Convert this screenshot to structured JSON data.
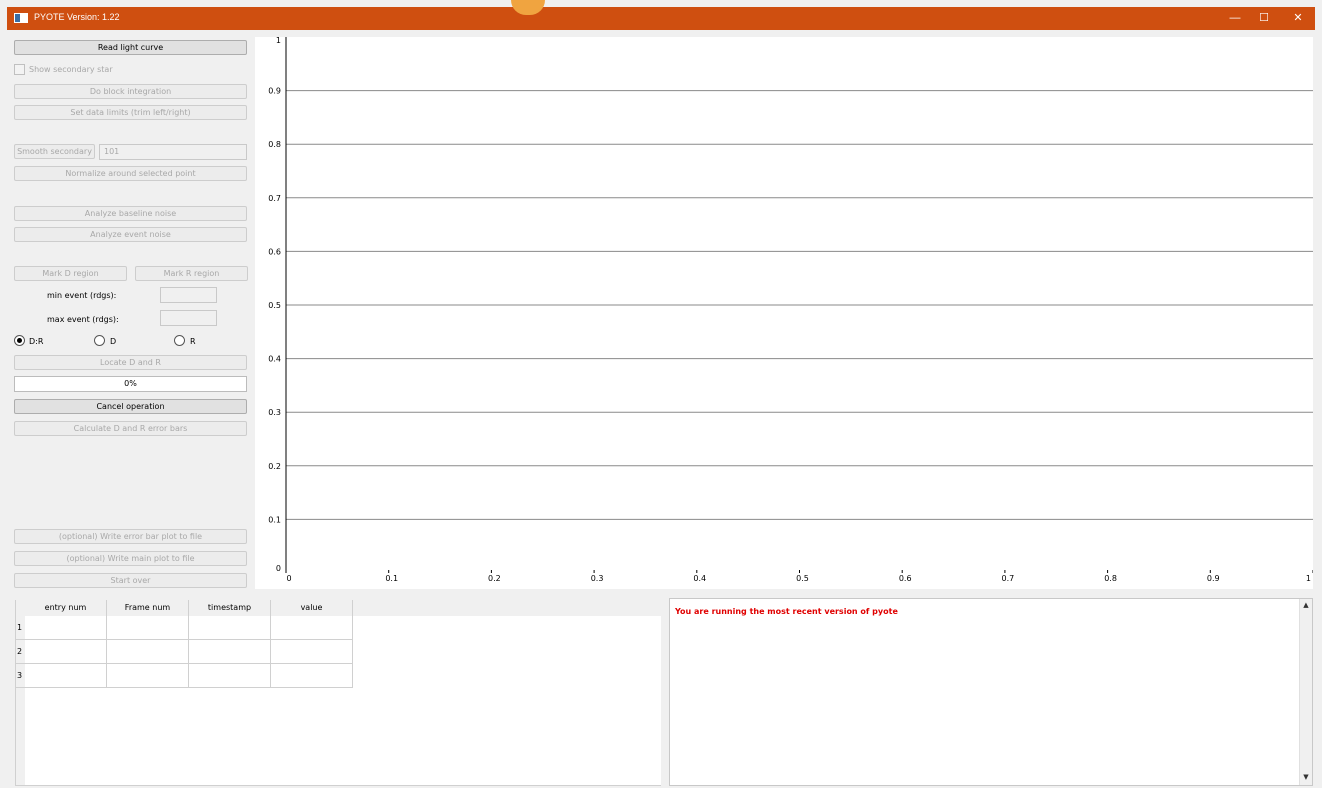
{
  "window": {
    "title": "PYOTE  Version: 1.22",
    "controls": {
      "minimize": "—",
      "maximize": "☐",
      "close": "✕"
    },
    "accent_color": "#cf4f10"
  },
  "left_panel": {
    "read_light_curve": "Read light curve",
    "show_secondary_star": "Show secondary star",
    "do_block_integration": "Do block integration",
    "set_data_limits": "Set data limits (trim left/right)",
    "smooth_secondary": "Smooth secondary",
    "smooth_value": "101",
    "normalize": "Normalize around selected point",
    "analyze_baseline_noise": "Analyze baseline noise",
    "analyze_event_noise": "Analyze event noise",
    "mark_d_region": "Mark D region",
    "mark_r_region": "Mark R region",
    "min_event_label": "min event (rdgs):",
    "min_event_value": "",
    "max_event_label": "max event (rdgs):",
    "max_event_value": "",
    "radio_options": [
      "D:R",
      "D",
      "R"
    ],
    "radio_selected": "D:R",
    "locate_d_and_r": "Locate D and R",
    "progress_text": "0%",
    "progress_fraction": 0,
    "cancel_operation": "Cancel operation",
    "calculate_error_bars": "Calculate D and R  error bars",
    "write_error_bar_plot": "(optional) Write error bar plot to file",
    "write_main_plot": "(optional) Write main plot to file",
    "start_over": "Start over"
  },
  "chart_data": {
    "type": "line",
    "series": [],
    "xlim": [
      0,
      1
    ],
    "ylim": [
      0,
      1
    ],
    "x_ticks": [
      "0",
      "0.1",
      "0.2",
      "0.3",
      "0.4",
      "0.5",
      "0.6",
      "0.7",
      "0.8",
      "0.9",
      "1"
    ],
    "y_ticks": [
      "0",
      "0.1",
      "0.2",
      "0.3",
      "0.4",
      "0.5",
      "0.6",
      "0.7",
      "0.8",
      "0.9",
      "1"
    ],
    "grid": "horizontal"
  },
  "table": {
    "columns": [
      "entry num",
      "Frame num",
      "timestamp",
      "value"
    ],
    "row_labels": [
      "1",
      "2",
      "3"
    ],
    "rows": [
      [
        "",
        "",
        "",
        ""
      ],
      [
        "",
        "",
        "",
        ""
      ],
      [
        "",
        "",
        "",
        ""
      ]
    ]
  },
  "log": {
    "message": "You are running the most recent version of pyote",
    "message_color": "#e00000",
    "scroll_up": "▲",
    "scroll_down": "▼"
  }
}
